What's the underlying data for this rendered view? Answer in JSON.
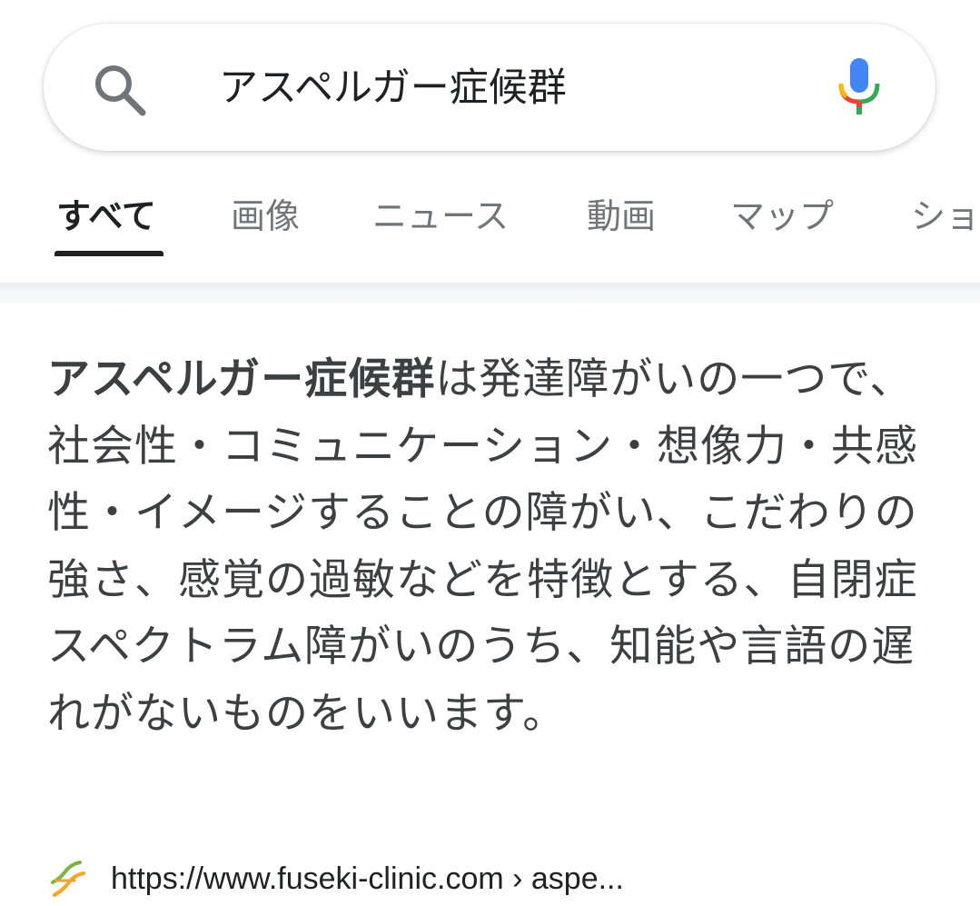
{
  "search": {
    "query": "アスペルガー症候群"
  },
  "icons": {
    "search": "search-icon",
    "mic": "microphone-icon",
    "favicon": "site-favicon-icon"
  },
  "colors": {
    "mic_blue": "#4285F4",
    "mic_red": "#EA4335",
    "mic_yellow": "#FBBC05",
    "mic_green": "#34A853",
    "text_primary": "#202124",
    "text_secondary": "#70757a"
  },
  "tabs": [
    {
      "label": "すべて",
      "active": true
    },
    {
      "label": "画像",
      "active": false
    },
    {
      "label": "ニュース",
      "active": false
    },
    {
      "label": "動画",
      "active": false
    },
    {
      "label": "マップ",
      "active": false
    },
    {
      "label": "ショ",
      "active": false
    }
  ],
  "snippet": {
    "bold_term": "アスペルガー症候群",
    "text": "は発達障がいの一つで、社会性・コミュニケーション・想像力・共感性・イメージすることの障がい、こだわりの強さ、感覚の過敏などを特徴とする、自閉症スペクトラム障がいのうち、知能や言語の遅れがないものをいいます。"
  },
  "source": {
    "url": "https://www.fuseki-clinic.com › aspe..."
  }
}
